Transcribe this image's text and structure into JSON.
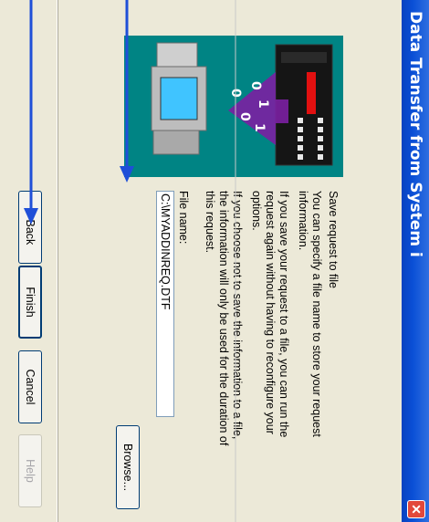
{
  "window": {
    "title": "Data Transfer from System i"
  },
  "content": {
    "heading": "Save request to file",
    "paragraph1_line1": "You can specify a file name to store your request",
    "paragraph1_line2": "information.",
    "paragraph2_line1": "If you save your request to a file, you can run the",
    "paragraph2_line2": "request again without having to reconfigure your",
    "paragraph2_line3": "options.",
    "paragraph3_line1": "If you choose not to save the information to a file,",
    "paragraph3_line2": "the information will only be used for the duration of",
    "paragraph3_line3": "this request.",
    "file_name_label": "File name:",
    "file_name_value": "C:\\MYADDINREQ.DTF",
    "browse_label": "Browse..."
  },
  "buttons": {
    "back_label": "< Back",
    "finish_label": "Finish",
    "cancel_label": "Cancel",
    "help_label": "Help"
  },
  "illustration": {
    "digits": [
      "0",
      "1",
      "0",
      "0",
      "1"
    ]
  },
  "colors": {
    "title_bar": "#0a4fd6",
    "dialog_bg": "#ece9d8",
    "illustration_bg": "#008484",
    "arrow": "#6a1b9a",
    "annotation": "#1f4fd8"
  }
}
